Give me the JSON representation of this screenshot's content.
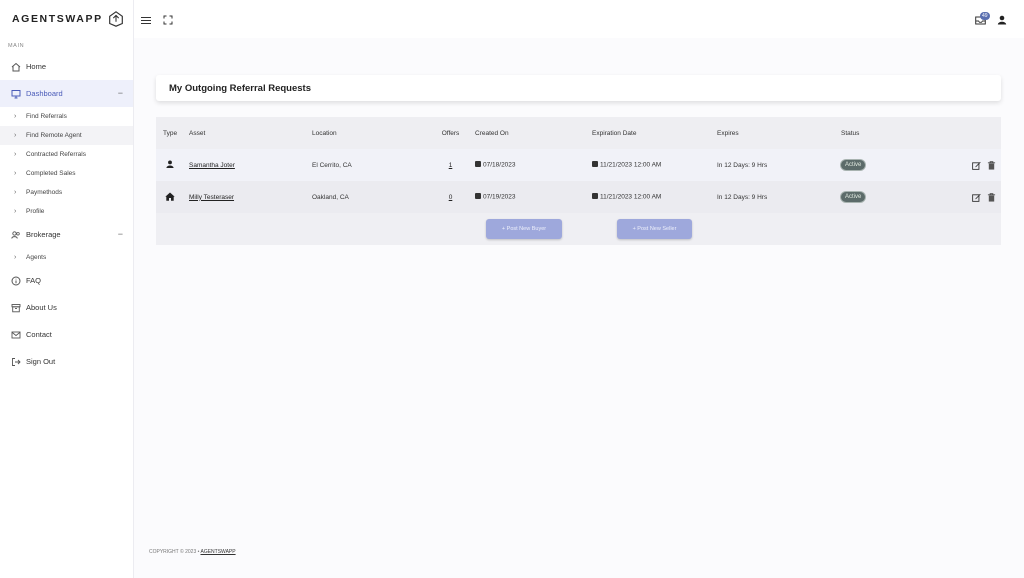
{
  "brand": {
    "name": "AGENTSWAPP"
  },
  "sidebar": {
    "section_label": "MAIN",
    "home": "Home",
    "dashboard": "Dashboard",
    "dashboard_subitems": [
      "Find Referrals",
      "Find Remote Agent",
      "Contracted Referrals",
      "Completed Sales",
      "Paymethods",
      "Profile"
    ],
    "brokerage": "Brokerage",
    "brokerage_subitems": [
      "Agents"
    ],
    "faq": "FAQ",
    "about": "About Us",
    "contact": "Contact",
    "signout": "Sign Out",
    "collapse_symbol": "−"
  },
  "topbar": {
    "notification_count": "49"
  },
  "page": {
    "title": "My Outgoing Referral Requests"
  },
  "table": {
    "columns": [
      "Type",
      "Asset",
      "Location",
      "Offers",
      "Created On",
      "Expiration Date",
      "Expires",
      "Status"
    ],
    "rows": [
      {
        "type_icon": "person-icon",
        "asset": "Samantha Joter",
        "location": "El Cerrito, CA",
        "offers": "1",
        "created": "07/18/2023",
        "expiration": "11/21/2023 12:00 AM",
        "expires": "In 12 Days: 9 Hrs",
        "status": "Active"
      },
      {
        "type_icon": "house-icon",
        "asset": "Milly Testeraser",
        "location": "Oakland, CA",
        "offers": "0",
        "created": "07/19/2023",
        "expiration": "11/21/2023 12:00 AM",
        "expires": "In 12 Days: 9 Hrs",
        "status": "Active"
      }
    ]
  },
  "buttons": {
    "post_buyer": "+ Post New Buyer",
    "post_seller": "+ Post New Seller"
  },
  "footer": {
    "copyright": "COPYRIGHT © 2023 •",
    "link": "AGENTSWAPP"
  },
  "colors": {
    "accent": "#4a5bb8",
    "button": "#9ea8dc",
    "status_pill": "#5c6b6a"
  }
}
